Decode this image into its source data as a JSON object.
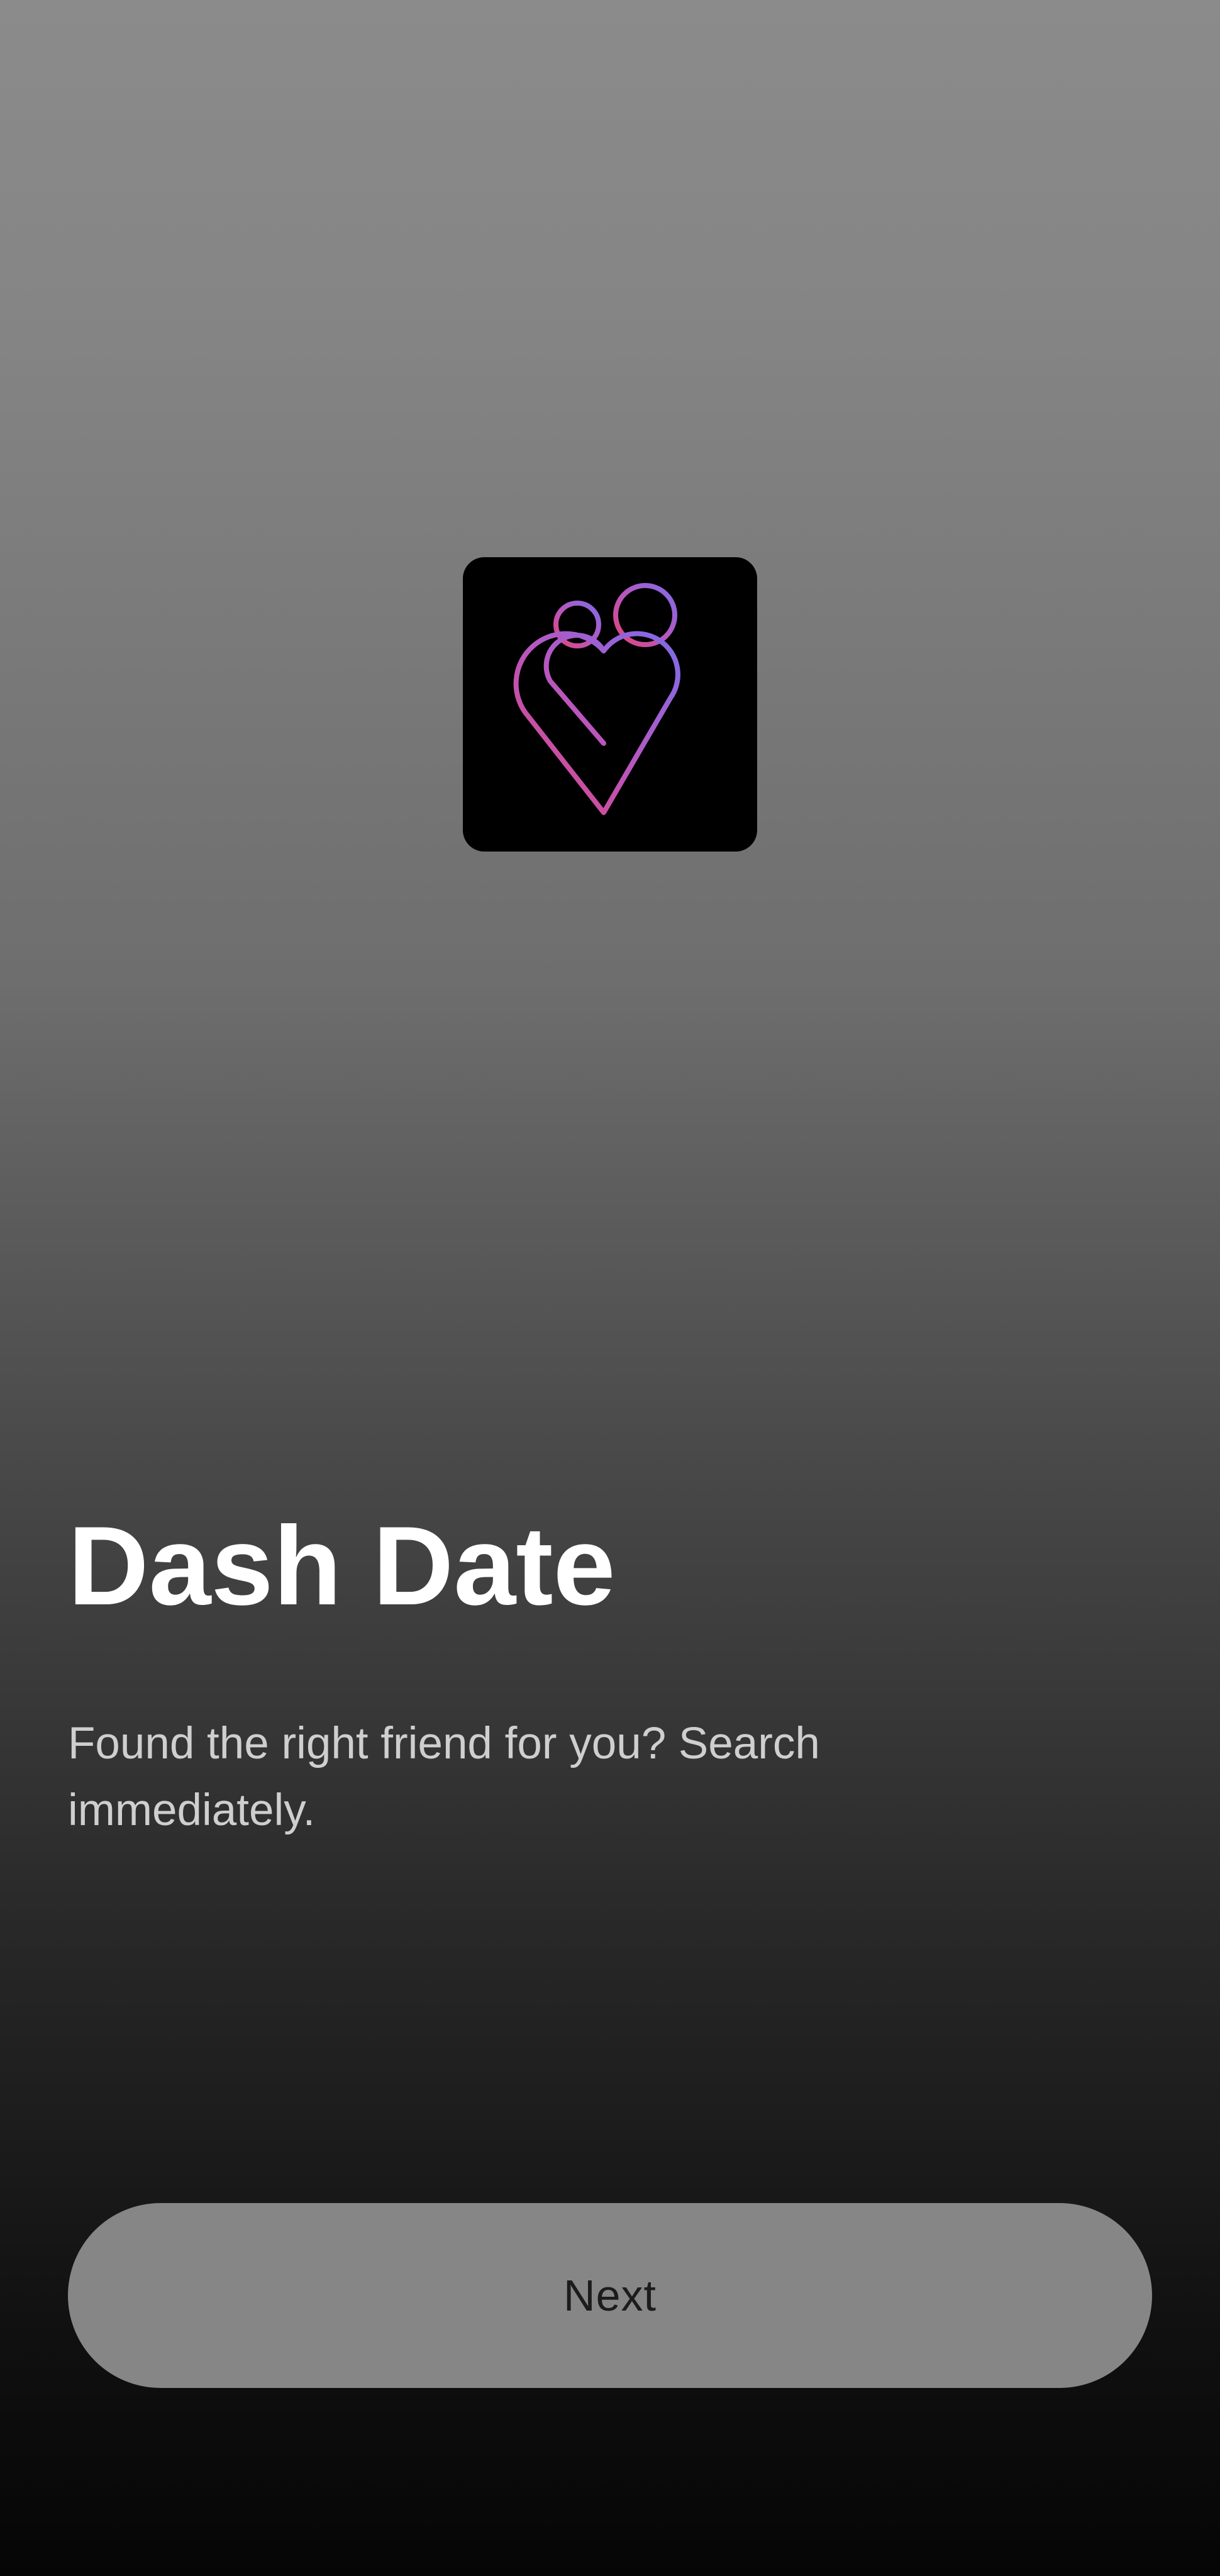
{
  "app": {
    "logo_icon": "heart-couple-icon",
    "logo_background_color": "#000000",
    "logo_gradient_colors": [
      "#e0457b",
      "#b757c0",
      "#7e6ce8"
    ]
  },
  "onboarding": {
    "title": "Dash Date",
    "subtitle": "Found the right friend for you? Search immediately."
  },
  "actions": {
    "next_label": "Next"
  },
  "theme": {
    "background_top": "#8b8b8b",
    "background_bottom": "#050505",
    "button_background": "#868686",
    "button_text": "#1c1c1c"
  }
}
